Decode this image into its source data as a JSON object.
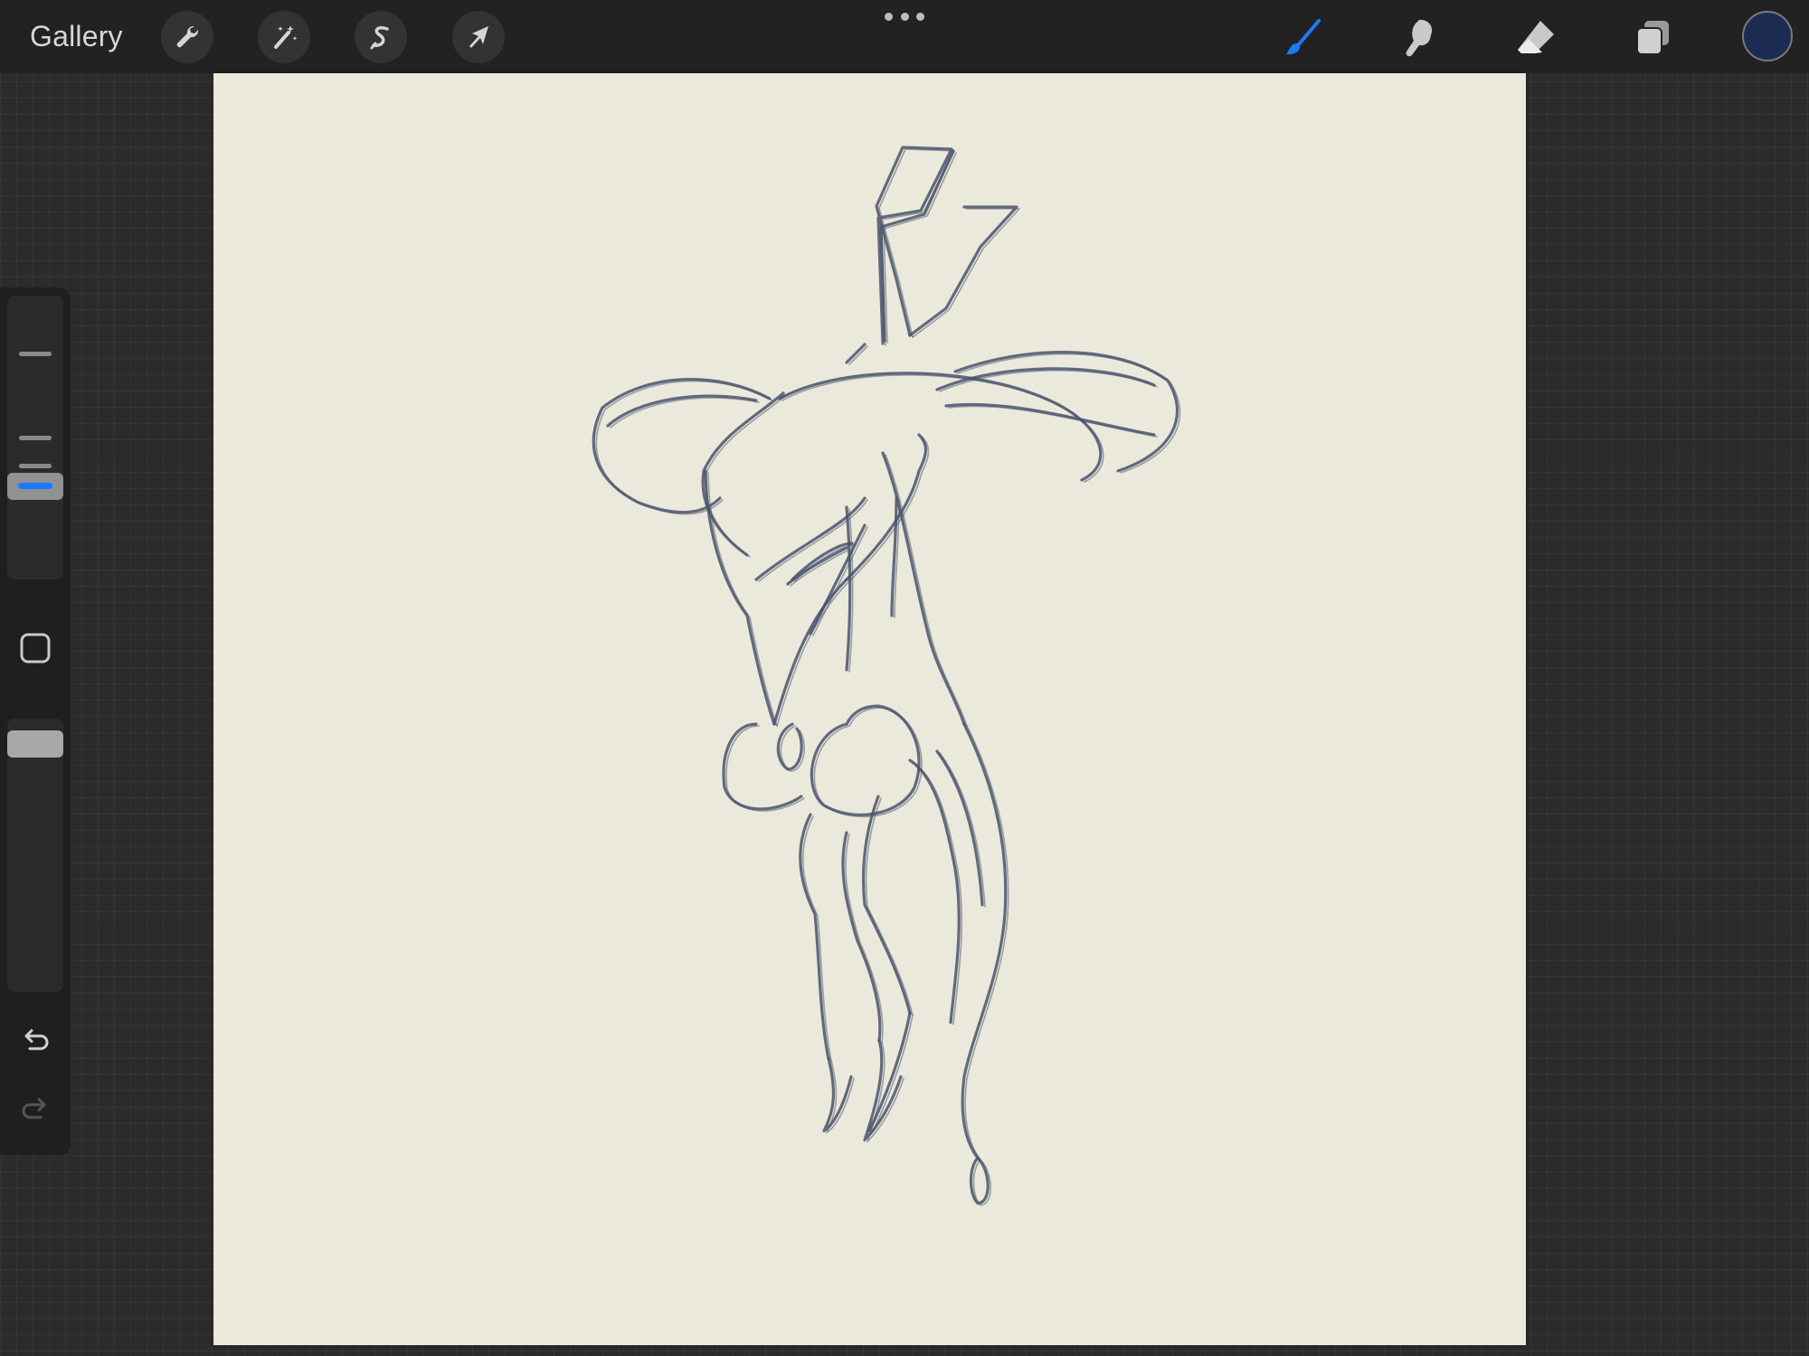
{
  "topbar": {
    "gallery_label": "Gallery",
    "left_tools": [
      {
        "name": "actions",
        "icon": "wrench-icon"
      },
      {
        "name": "adjustments",
        "icon": "magic-wand-icon"
      },
      {
        "name": "selection",
        "icon": "selection-s-icon"
      },
      {
        "name": "transform",
        "icon": "cursor-arrow-icon"
      }
    ],
    "right_tools": [
      {
        "name": "brush",
        "icon": "brush-icon",
        "active": true
      },
      {
        "name": "smudge",
        "icon": "smudge-finger-icon",
        "active": false
      },
      {
        "name": "eraser",
        "icon": "eraser-icon",
        "active": false
      },
      {
        "name": "layers",
        "icon": "layers-icon",
        "active": false
      }
    ],
    "more_icon": "more-dots-icon",
    "current_color": "#1c2b52"
  },
  "colors": {
    "accent": "#1a7bff",
    "canvas_bg": "#ebe9db",
    "ink": "#2a3757",
    "chrome_bg": "#222223"
  },
  "sidebar": {
    "brush_size": 0.4,
    "opacity": 0.95,
    "modify_icon": "square-modify-icon",
    "undo_icon": "undo-icon",
    "redo_icon": "redo-icon"
  }
}
